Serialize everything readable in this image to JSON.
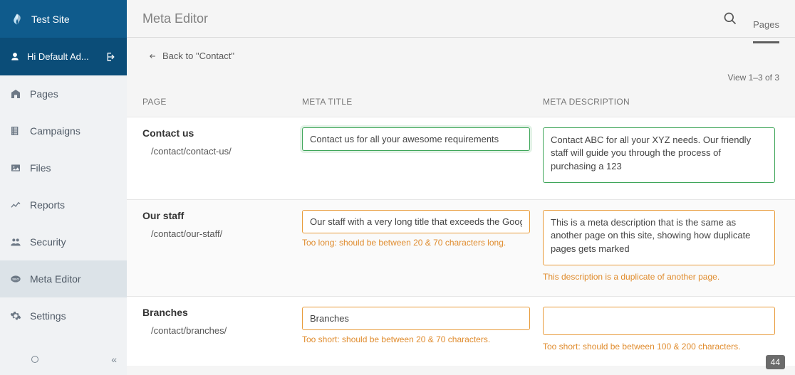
{
  "brand": {
    "name": "Test Site"
  },
  "user": {
    "greeting": "Hi Default Ad..."
  },
  "nav": {
    "items": [
      {
        "label": "Pages"
      },
      {
        "label": "Campaigns"
      },
      {
        "label": "Files"
      },
      {
        "label": "Reports"
      },
      {
        "label": "Security"
      },
      {
        "label": "Meta Editor"
      },
      {
        "label": "Settings"
      }
    ]
  },
  "header": {
    "title": "Meta Editor",
    "tab": "Pages"
  },
  "back": {
    "label": "Back to \"Contact\""
  },
  "viewcount": "View 1–3 of 3",
  "columns": {
    "page": "PAGE",
    "title": "META TITLE",
    "desc": "META DESCRIPTION"
  },
  "rows": [
    {
      "name": "Contact us",
      "url": "/contact/contact-us/",
      "title": "Contact us for all your awesome requirements",
      "title_hint": "",
      "desc": "Contact ABC for all your XYZ needs. Our friendly staff will guide you through the process of purchasing a 123",
      "desc_hint": "",
      "status": "ok"
    },
    {
      "name": "Our staff",
      "url": "/contact/our-staff/",
      "title": "Our staff with a very long title that exceeds the Goog",
      "title_hint": "Too long: should be between 20 & 70 characters long.",
      "desc": "This is a meta description that is the same as another page on this site, showing how duplicate pages gets marked",
      "desc_hint": "This description is a duplicate of another page.",
      "status": "warn"
    },
    {
      "name": "Branches",
      "url": "/contact/branches/",
      "title": "Branches",
      "title_hint": "Too short: should be between 20 & 70 characters.",
      "desc": "",
      "desc_hint": "Too short: should be between 100 & 200 characters.",
      "status": "warn"
    }
  ],
  "badge": "44"
}
